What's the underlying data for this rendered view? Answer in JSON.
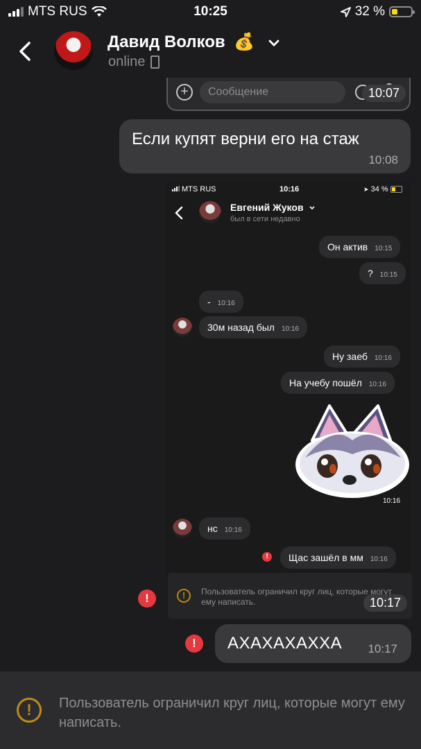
{
  "status_bar": {
    "carrier": "MTS RUS",
    "time": "10:25",
    "battery": "32 %",
    "battery_level": 0.32,
    "colors": {
      "battery_fill": "#ffd60a"
    }
  },
  "header": {
    "name": "Давид Волков",
    "name_emoji": "💰",
    "status": "online",
    "icons": [
      "back-chevron-icon",
      "chevron-down-icon",
      "phone-device-icon"
    ]
  },
  "cut_screenshot": {
    "placeholder": "Сообщение",
    "time": "10:07"
  },
  "message_1": {
    "text": "Если купят верни его на стаж",
    "time": "10:08"
  },
  "inner_screenshot": {
    "status": {
      "carrier": "MTS RUS",
      "time": "10:16",
      "battery": "34 %"
    },
    "contact_name": "Евгений Жуков",
    "contact_status": "был в сети недавно",
    "messages": [
      {
        "text": "Он актив",
        "time": "10:15",
        "side": "out"
      },
      {
        "text": "?",
        "time": "10:15",
        "side": "out"
      },
      {
        "text": "-",
        "time": "10:16",
        "side": "in"
      },
      {
        "text": "30м назад был",
        "time": "10:16",
        "side": "in"
      },
      {
        "text": "Ну заеб",
        "time": "10:16",
        "side": "out"
      },
      {
        "text": "На учебу пошёл",
        "time": "10:16",
        "side": "out"
      },
      {
        "text": "",
        "time": "10:16",
        "side": "out",
        "type": "sticker"
      },
      {
        "text": "нс",
        "time": "10:16",
        "side": "in"
      },
      {
        "text": "Щас зашёл в мм",
        "time": "10:16",
        "side": "out"
      }
    ],
    "warning": "Пользователь ограничил круг лиц, которые могут ему написать.",
    "warning_time": "10:17"
  },
  "message_2": {
    "text": "АХАХАХАХХА",
    "time": "10:17"
  },
  "footer": {
    "notice": "Пользователь ограничил круг лиц, которые могут ему написать."
  },
  "colors": {
    "background": "#1c1c1e",
    "bubble": "#3a3a3c",
    "error": "#e5393f",
    "warning": "#c08a1a"
  }
}
